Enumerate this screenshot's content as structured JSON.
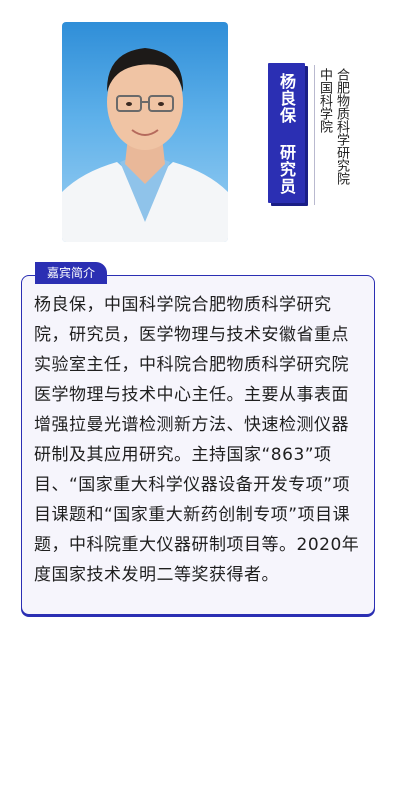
{
  "profile": {
    "name_title": "杨良保 研究员",
    "affiliation": "合肥物质科学研究院 中国科学院",
    "portrait_icon": "person-portrait"
  },
  "intro": {
    "label": "嘉宾简介",
    "text": "杨良保，中国科学院合肥物质科学研究院，研究员，医学物理与技术安徽省重点实验室主任，中科院合肥物质科学研究院医学物理与技术中心主任。主要从事表面增强拉曼光谱检测新方法、快速检测仪器研制及其应用研究。主持国家“863”项目、“国家重大科学仪器设备开发专项”项目课题和“国家重大新药创制专项”项目课题，中科院重大仪器研制项目等。2020年度国家技术发明二等奖获得者。"
  },
  "colors": {
    "accent": "#2b2fb3",
    "card_background": "#f6f5fc"
  }
}
